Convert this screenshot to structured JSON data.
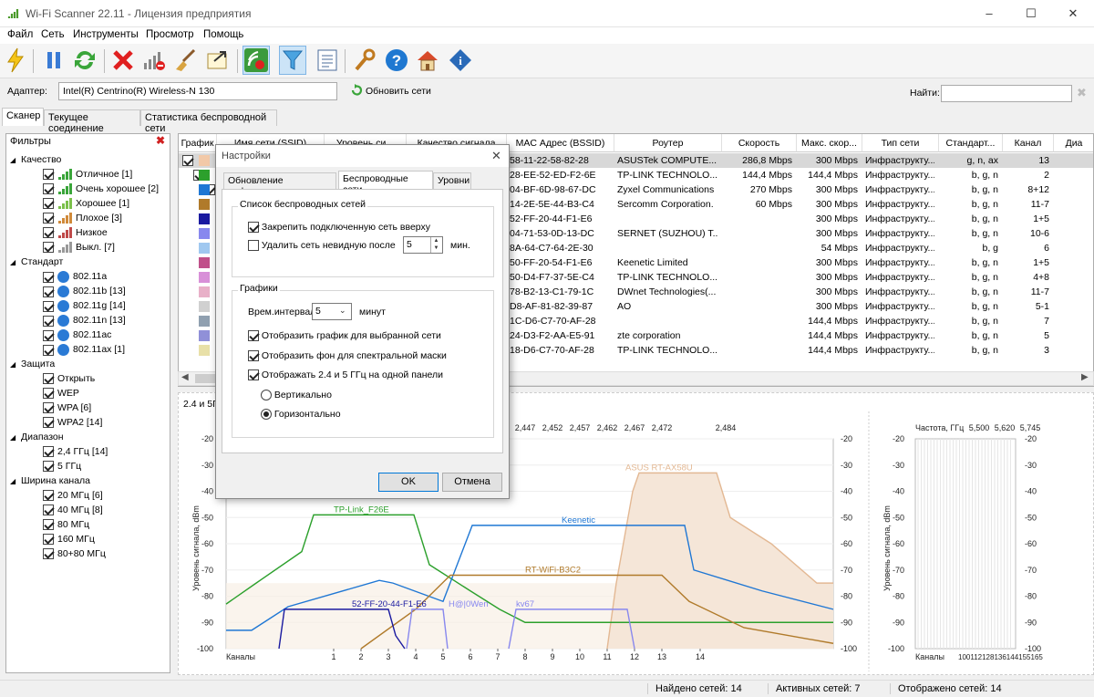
{
  "window": {
    "title": "Wi-Fi Scanner 22.11 - Лицензия предприятия"
  },
  "menu": [
    "Файл",
    "Сеть",
    "Инструменты",
    "Просмотр",
    "Помощь"
  ],
  "adapter": {
    "label": "Адаптер:",
    "value": "Intel(R) Centrino(R) Wireless-N 130",
    "refresh": "Обновить сети",
    "find_label": "Найти:"
  },
  "tabs": [
    "Сканер",
    "Текущее соединение",
    "Статистика беспроводной сети"
  ],
  "filters": {
    "title": "Фильтры",
    "groups": [
      {
        "name": "Качество",
        "items": [
          "Отличное [1]",
          "Очень хорошее [2]",
          "Хорошее [1]",
          "Плохое [3]",
          "Низкое",
          "Выкл. [7]"
        ]
      },
      {
        "name": "Стандарт",
        "items": [
          "802.11a",
          "802.11b [13]",
          "802.11g [14]",
          "802.11n [13]",
          "802.11ac",
          "802.11ax [1]"
        ]
      },
      {
        "name": "Защита",
        "items": [
          "Открыть",
          "WEP",
          "WPA [6]",
          "WPA2 [14]"
        ]
      },
      {
        "name": "Диапазон",
        "items": [
          "2,4 ГГц [14]",
          "5 ГГц"
        ]
      },
      {
        "name": "Ширина канала",
        "items": [
          "20 МГц [6]",
          "40 МГц [8]",
          "80 МГц",
          "160 МГц",
          "80+80 МГц"
        ]
      }
    ]
  },
  "grid": {
    "headers": [
      "График",
      "Имя сети (SSID)",
      "Уровень си...",
      "Качество сигнала",
      "MAC Адрес (BSSID)",
      "Роутер",
      "Скорость",
      "Макс. скор...",
      "Тип сети",
      "Стандарт...",
      "Канал",
      "Диа"
    ],
    "rows": [
      {
        "color": "#f2c9a8",
        "mac": "58-11-22-58-82-28",
        "router": "ASUSTek COMPUTE...",
        "speed": "286,8 Mbps",
        "max": "300 Mbps",
        "type": "Инфраструкту...",
        "std": "g, n, ax",
        "ch": "13"
      },
      {
        "color": "#2ca02c",
        "mac": "28-EE-52-ED-F2-6E",
        "router": "TP-LINK TECHNOLO...",
        "speed": "144,4 Mbps",
        "max": "144,4 Mbps",
        "type": "Инфраструкту...",
        "std": "b, g, n",
        "ch": "2"
      },
      {
        "color": "#1f77d4",
        "mac": "04-BF-6D-98-67-DC",
        "router": "Zyxel Communications ...",
        "speed": "270 Mbps",
        "max": "300 Mbps",
        "type": "Инфраструкту...",
        "std": "b, g, n",
        "ch": "8+12"
      },
      {
        "color": "#b07a2a",
        "mac": "14-2E-5E-44-B3-C4",
        "router": "Sercomm Corporation.",
        "speed": "60 Mbps",
        "max": "300 Mbps",
        "type": "Инфраструкту...",
        "std": "b, g, n",
        "ch": "11-7"
      },
      {
        "color": "#1a1aa0",
        "mac": "52-FF-20-44-F1-E6",
        "router": "",
        "speed": "",
        "max": "300 Mbps",
        "type": "Инфраструкту...",
        "std": "b, g, n",
        "ch": "1+5"
      },
      {
        "color": "#8888ee",
        "mac": "04-71-53-0D-13-DC",
        "router": "SERNET (SUZHOU) T...",
        "speed": "",
        "max": "300 Mbps",
        "type": "Инфраструкту...",
        "std": "b, g, n",
        "ch": "10-6"
      },
      {
        "color": "#a0c8f0",
        "mac": "8A-64-C7-64-2E-30",
        "router": "",
        "speed": "",
        "max": "54 Mbps",
        "type": "Инфраструкту...",
        "std": "b, g",
        "ch": "6"
      },
      {
        "color": "#c0508a",
        "mac": "50-FF-20-54-F1-E6",
        "router": "Keenetic Limited",
        "speed": "",
        "max": "300 Mbps",
        "type": "Инфраструкту...",
        "std": "b, g, n",
        "ch": "1+5"
      },
      {
        "color": "#d890d8",
        "mac": "50-D4-F7-37-5E-C4",
        "router": "TP-LINK TECHNOLO...",
        "speed": "",
        "max": "300 Mbps",
        "type": "Инфраструкту...",
        "std": "b, g, n",
        "ch": "4+8"
      },
      {
        "color": "#e8b0c8",
        "mac": "78-B2-13-C1-79-1C",
        "router": "DWnet Technologies(...",
        "speed": "",
        "max": "300 Mbps",
        "type": "Инфраструкту...",
        "std": "b, g, n",
        "ch": "11-7"
      },
      {
        "color": "#d0d0d0",
        "mac": "D8-AF-81-82-39-87",
        "router": "AO",
        "speed": "",
        "max": "300 Mbps",
        "type": "Инфраструкту...",
        "std": "b, g, n",
        "ch": "5-1"
      },
      {
        "color": "#90a0b0",
        "mac": "1C-D6-C7-70-AF-28",
        "router": "",
        "speed": "",
        "max": "144,4 Mbps",
        "type": "Инфраструкту...",
        "std": "b, g, n",
        "ch": "7"
      },
      {
        "color": "#9090d8",
        "mac": "24-D3-F2-AA-E5-91",
        "router": "zte corporation",
        "speed": "",
        "max": "144,4 Mbps",
        "type": "Инфраструкту...",
        "std": "b, g, n",
        "ch": "5"
      },
      {
        "color": "#e8e0a8",
        "mac": "18-D6-C7-70-AF-28",
        "router": "TP-LINK TECHNOLO...",
        "speed": "",
        "max": "144,4 Mbps",
        "type": "Инфраструкту...",
        "std": "b, g, n",
        "ch": "3"
      }
    ]
  },
  "chart": {
    "band_label": "2.4 и 5ГГц",
    "ylabel": "Уровень сигнала, dBm",
    "xlabel": "Каналы",
    "freq_label": "Частота, ГГц",
    "yticks": [
      "-20",
      "-30",
      "-40",
      "-50",
      "-60",
      "-70",
      "-80",
      "-90",
      "-100"
    ],
    "channels": [
      "1",
      "2",
      "3",
      "4",
      "5",
      "6",
      "7",
      "8",
      "9",
      "10",
      "11",
      "12",
      "13",
      "14"
    ],
    "freqs_24": [
      "2,447",
      "2,452",
      "2,457",
      "2,462",
      "2,467",
      "2,472",
      "2,484"
    ],
    "freqs_5": [
      "5,500",
      "5,620",
      "5,745"
    ],
    "ch5": "100112128136144155165",
    "network_labels": [
      "ASUS RT-AX58U",
      "TP-Link_F26E",
      "Keenetic",
      "RT-WiFi-B3C2",
      "52-FF-20-44-F1-E6",
      "H@|0Wen",
      "kv67"
    ]
  },
  "status": {
    "found": "Найдено сетей: 14",
    "active": "Активных сетей: 7",
    "shown": "Отображено сетей: 14"
  },
  "dialog": {
    "title": "Настройки",
    "tabs": [
      "Обновление информации",
      "Беспроводные сети",
      "Уровни"
    ],
    "list_group": "Список беспроводных сетей",
    "pin": "Закрепить подключенную сеть вверху",
    "remove": "Удалить сеть невидную после",
    "remove_value": "5",
    "remove_unit": "мин.",
    "graph_group": "Графики",
    "interval_label": "Врем.интервал",
    "interval_value": "5",
    "interval_unit": "минут",
    "opt1": "Отобразить график для выбранной сети",
    "opt2": "Отобразить фон для спектральной маски",
    "opt3": "Отображать 2.4 и 5 ГГц на одной панели",
    "vertical": "Вертикально",
    "horizontal": "Горизонтально",
    "ok": "OK",
    "cancel": "Отмена"
  }
}
